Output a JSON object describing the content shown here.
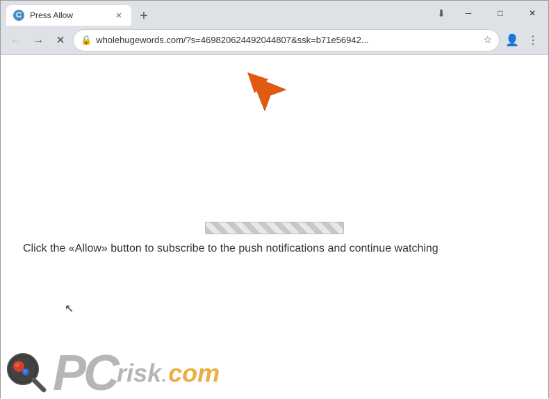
{
  "window": {
    "title": "Press Allow",
    "url": "wholehugewords.com/?s=469820624492044807&ssk=b71e56942...",
    "url_full": "wholehugewords.com/?s=469820624492044807&ssk=b71e56942...",
    "tab_title": "Press Allow"
  },
  "toolbar": {
    "back_label": "←",
    "forward_label": "→",
    "close_label": "✕",
    "new_tab_label": "+",
    "minimize_label": "─",
    "maximize_label": "□",
    "window_close_label": "✕",
    "menu_label": "⋮",
    "profile_label": "👤",
    "star_label": "☆",
    "download_label": "⬇"
  },
  "page": {
    "click_text": "Click the «Allow» button to subscribe to the push notifications and continue watching",
    "logo_pc": "PC",
    "logo_risk": "risk",
    "logo_dot": ".",
    "logo_com": "com"
  },
  "icons": {
    "lock": "🔒",
    "arrow_color": "#e05a14"
  }
}
